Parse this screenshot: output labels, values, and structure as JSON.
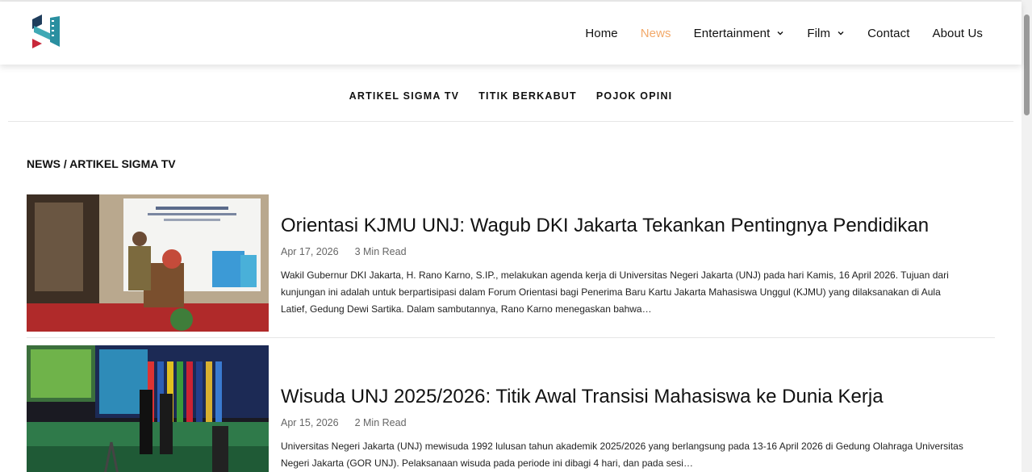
{
  "header": {
    "nav": [
      {
        "label": "Home",
        "dropdown": false,
        "active": false
      },
      {
        "label": "News",
        "dropdown": false,
        "active": true
      },
      {
        "label": "Entertainment",
        "dropdown": true,
        "active": false
      },
      {
        "label": "Film",
        "dropdown": true,
        "active": false
      },
      {
        "label": "Contact",
        "dropdown": false,
        "active": false
      },
      {
        "label": "About Us",
        "dropdown": false,
        "active": false
      }
    ],
    "accent_color": "#f2a96a"
  },
  "subnav": [
    "ARTIKEL SIGMA TV",
    "TITIK BERKABUT",
    "POJOK OPINI"
  ],
  "breadcrumb": "NEWS / ARTIKEL SIGMA TV",
  "articles": [
    {
      "title": "Orientasi KJMU UNJ: Wagub DKI Jakarta Tekankan Pentingnya Pendidikan",
      "date": "Apr 17, 2026",
      "read": "3 Min Read",
      "excerpt": "Wakil Gubernur DKI Jakarta, H. Rano Karno, S.IP., melakukan agenda kerja di Universitas Negeri Jakarta (UNJ) pada hari Kamis, 16 April 2026. Tujuan dari kunjungan ini adalah untuk berpartisipasi dalam Forum Orientasi bagi Penerima Baru Kartu Jakarta Mahasiswa Unggul (KJMU) yang dilaksanakan di Aula Latief, Gedung Dewi Sartika. Dalam sambutannya, Rano Karno menegaskan bahwa…"
    },
    {
      "title": "Wisuda UNJ 2025/2026: Titik Awal Transisi Mahasiswa ke Dunia Kerja",
      "date": "Apr 15, 2026",
      "read": "2 Min Read",
      "excerpt": "Universitas Negeri Jakarta (UNJ) mewisuda 1992 lulusan tahun akademik 2025/2026 yang berlangsung pada 13-16 April 2026 di Gedung Olahraga Universitas Negeri Jakarta (GOR UNJ). Pelaksanaan wisuda pada periode ini dibagi 4 hari, dan pada sesi…"
    }
  ]
}
